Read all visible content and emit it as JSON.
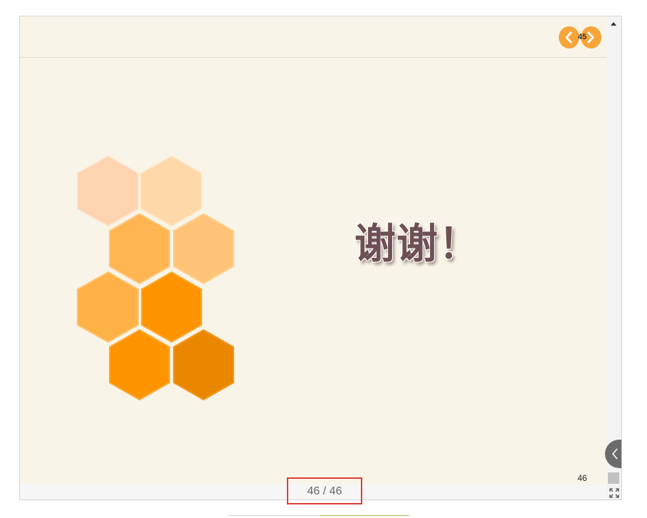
{
  "slide": {
    "title_text": "谢谢！",
    "slide_number": "46",
    "background": "#f8f5e8"
  },
  "navigation": {
    "prev_icon": "chevron-left-icon",
    "next_icon": "chevron-right-icon",
    "current_page_badge": "45",
    "accent_color": "#f7a53a"
  },
  "viewer": {
    "page_indicator": "46 / 46",
    "side_toggle_icon": "chevron-left-icon",
    "fullscreen_icon": "expand-icon"
  },
  "hexagons": {
    "colors": [
      "#fdd3b0",
      "#fed8a8",
      "#feb552",
      "#fec376",
      "#feb146",
      "#fe9400",
      "#fe9400",
      "#e98700"
    ]
  }
}
